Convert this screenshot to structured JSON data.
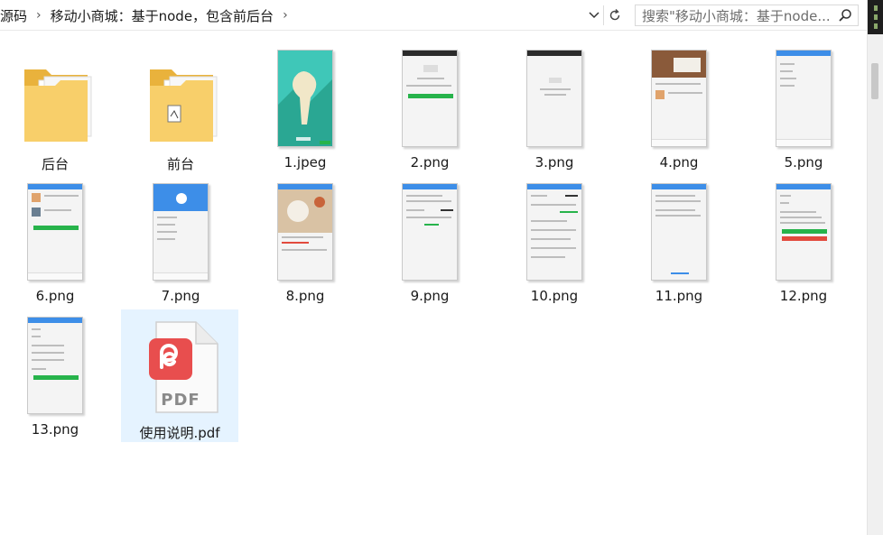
{
  "breadcrumb": {
    "items": [
      "源码",
      "移动小商城：基于node，包含前后台"
    ],
    "chevron": "›"
  },
  "search": {
    "placeholder": "搜索\"移动小商城：基于node..."
  },
  "files": [
    {
      "name": "后台",
      "kind": "folder"
    },
    {
      "name": "前台",
      "kind": "folder"
    },
    {
      "name": "1.jpeg",
      "kind": "image"
    },
    {
      "name": "2.png",
      "kind": "image"
    },
    {
      "name": "3.png",
      "kind": "image"
    },
    {
      "name": "4.png",
      "kind": "image"
    },
    {
      "name": "5.png",
      "kind": "image"
    },
    {
      "name": "6.png",
      "kind": "image"
    },
    {
      "name": "7.png",
      "kind": "image"
    },
    {
      "name": "8.png",
      "kind": "image"
    },
    {
      "name": "9.png",
      "kind": "image"
    },
    {
      "name": "10.png",
      "kind": "image"
    },
    {
      "name": "11.png",
      "kind": "image"
    },
    {
      "name": "12.png",
      "kind": "image"
    },
    {
      "name": "13.png",
      "kind": "image"
    },
    {
      "name": "使用说明.pdf",
      "kind": "pdf",
      "badge": "PDF"
    }
  ],
  "colors": {
    "folder": "#f6c14c",
    "selected": "#e5f3ff",
    "pdf_icon": "#e84e4e",
    "accent_green": "#27b34b",
    "phone_bar": "#3d8ee8"
  }
}
